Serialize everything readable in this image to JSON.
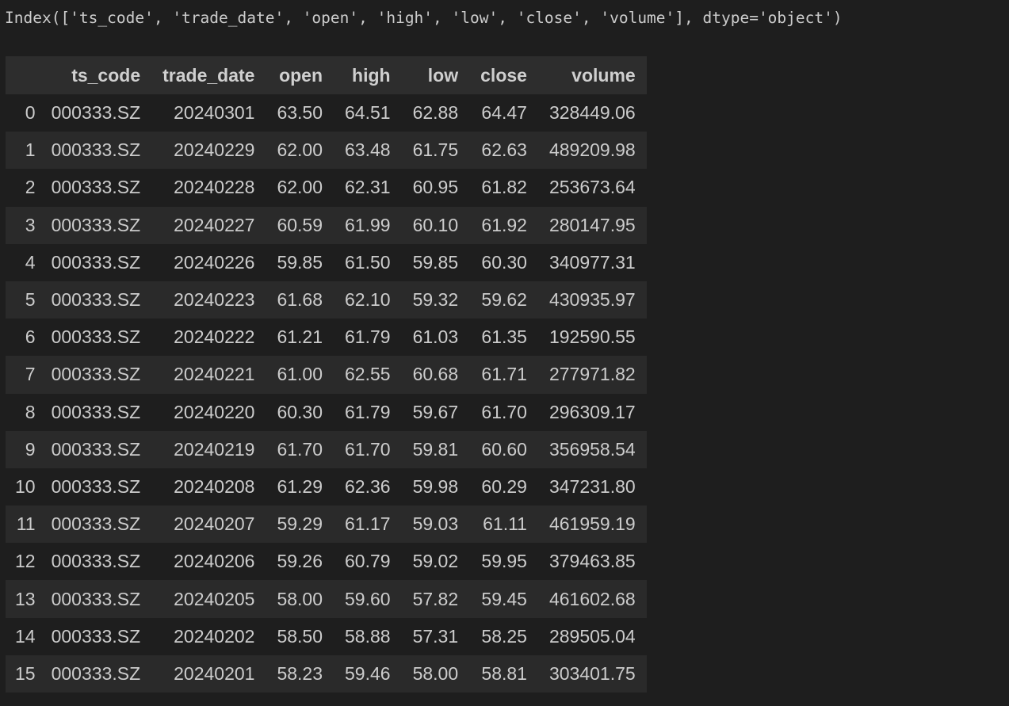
{
  "output": {
    "index_text": "Index(['ts_code', 'trade_date', 'open', 'high', 'low', 'close', 'volume'], dtype='object')"
  },
  "table": {
    "index_header": "",
    "columns": [
      "ts_code",
      "trade_date",
      "open",
      "high",
      "low",
      "close",
      "volume"
    ],
    "rows": [
      {
        "index": "0",
        "cells": [
          "000333.SZ",
          "20240301",
          "63.50",
          "64.51",
          "62.88",
          "64.47",
          "328449.06"
        ]
      },
      {
        "index": "1",
        "cells": [
          "000333.SZ",
          "20240229",
          "62.00",
          "63.48",
          "61.75",
          "62.63",
          "489209.98"
        ]
      },
      {
        "index": "2",
        "cells": [
          "000333.SZ",
          "20240228",
          "62.00",
          "62.31",
          "60.95",
          "61.82",
          "253673.64"
        ]
      },
      {
        "index": "3",
        "cells": [
          "000333.SZ",
          "20240227",
          "60.59",
          "61.99",
          "60.10",
          "61.92",
          "280147.95"
        ]
      },
      {
        "index": "4",
        "cells": [
          "000333.SZ",
          "20240226",
          "59.85",
          "61.50",
          "59.85",
          "60.30",
          "340977.31"
        ]
      },
      {
        "index": "5",
        "cells": [
          "000333.SZ",
          "20240223",
          "61.68",
          "62.10",
          "59.32",
          "59.62",
          "430935.97"
        ]
      },
      {
        "index": "6",
        "cells": [
          "000333.SZ",
          "20240222",
          "61.21",
          "61.79",
          "61.03",
          "61.35",
          "192590.55"
        ]
      },
      {
        "index": "7",
        "cells": [
          "000333.SZ",
          "20240221",
          "61.00",
          "62.55",
          "60.68",
          "61.71",
          "277971.82"
        ]
      },
      {
        "index": "8",
        "cells": [
          "000333.SZ",
          "20240220",
          "60.30",
          "61.79",
          "59.67",
          "61.70",
          "296309.17"
        ]
      },
      {
        "index": "9",
        "cells": [
          "000333.SZ",
          "20240219",
          "61.70",
          "61.70",
          "59.81",
          "60.60",
          "356958.54"
        ]
      },
      {
        "index": "10",
        "cells": [
          "000333.SZ",
          "20240208",
          "61.29",
          "62.36",
          "59.98",
          "60.29",
          "347231.80"
        ]
      },
      {
        "index": "11",
        "cells": [
          "000333.SZ",
          "20240207",
          "59.29",
          "61.17",
          "59.03",
          "61.11",
          "461959.19"
        ]
      },
      {
        "index": "12",
        "cells": [
          "000333.SZ",
          "20240206",
          "59.26",
          "60.79",
          "59.02",
          "59.95",
          "379463.85"
        ]
      },
      {
        "index": "13",
        "cells": [
          "000333.SZ",
          "20240205",
          "58.00",
          "59.60",
          "57.82",
          "59.45",
          "461602.68"
        ]
      },
      {
        "index": "14",
        "cells": [
          "000333.SZ",
          "20240202",
          "58.50",
          "58.88",
          "57.31",
          "58.25",
          "289505.04"
        ]
      },
      {
        "index": "15",
        "cells": [
          "000333.SZ",
          "20240201",
          "58.23",
          "59.46",
          "58.00",
          "58.81",
          "303401.75"
        ]
      }
    ]
  },
  "colors": {
    "background": "#1e1e1e",
    "header_background": "#2d2d2d",
    "stripe_background": "#2a2a2a",
    "text": "#cccccc"
  }
}
